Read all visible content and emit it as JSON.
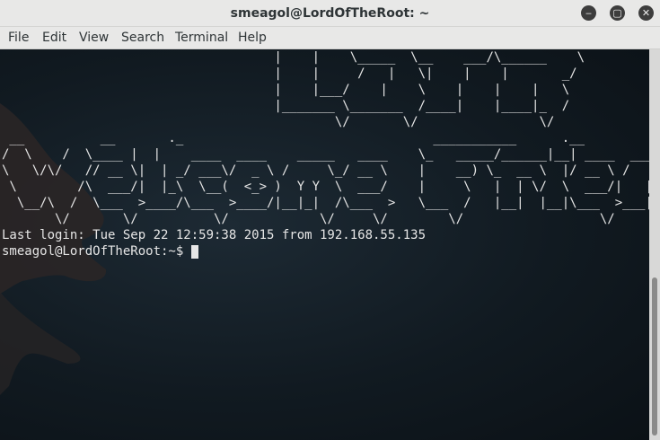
{
  "window": {
    "title": "smeagol@LordOfTheRoot: ~",
    "minimize_icon": "minimize-icon",
    "maximize_icon": "maximize-icon",
    "close_icon": "close-icon",
    "minimize_glyph": "‒",
    "maximize_glyph": "▢",
    "close_glyph": "✕"
  },
  "menu": {
    "items": [
      "File",
      "Edit",
      "View",
      "Search",
      "Terminal",
      "Help"
    ]
  },
  "terminal": {
    "background_color": "#0d1419",
    "text_color": "#e6e6e6",
    "background_image": "dragon-watermark",
    "lines": [
      "                                    |    |    \\_____  \\__    ___/\\______    \\",
      "                                    |    |     /   |   \\|    |    |       _/",
      "                                    |    |___/    |    \\    |    |    |   \\",
      "                                    |_______ \\_______  /____|    |____|_  /",
      "                                            \\/       \\/                \\/",
      " __          __       ._                                 ___________      .__",
      "/  \\    /  \\____ |  |    ____  ____    _____   ____    \\_   _____/______|__| ____  ____   __| _/",
      "\\   \\/\\/   // __ \\|  | _/ ___\\/  _ \\ /     \\_/ __ \\    |    __) \\_  __ \\  |/ __ \\ /    \\ / __ |",
      " \\        /\\  ___/|  |_\\  \\__(  <_> )  Y Y  \\  ___/    |     \\   |  | \\/  \\  ___/|   |  \\/ /_/ |",
      "  \\__/\\  /  \\___  >____/\\___  >____/|__|_|  /\\___  >   \\___  /   |__|  |__|\\___  >___|  /\\____ |",
      "       \\/       \\/          \\/            \\/     \\/        \\/                  \\/     \\/      \\/",
      "Last login: Tue Sep 22 12:59:38 2015 from 192.168.55.135",
      "smeagol@LordOfTheRoot:~$ "
    ]
  }
}
